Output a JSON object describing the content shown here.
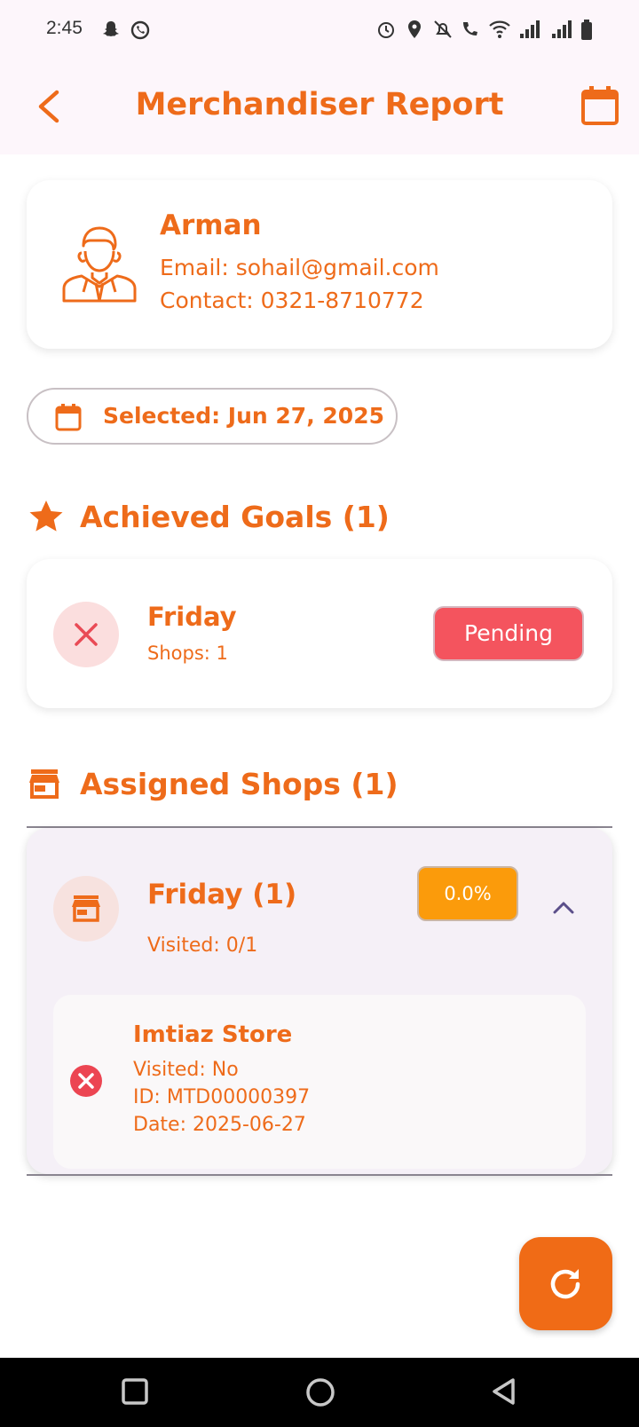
{
  "status_bar": {
    "time": "2:45"
  },
  "app_bar": {
    "title": "Merchandiser Report",
    "back_icon": "chevron-left-icon",
    "calendar_icon": "calendar-icon"
  },
  "profile": {
    "name": "Arman",
    "email": "Email: sohail@gmail.com",
    "contact": "Contact: 0321-8710772",
    "avatar_icon": "person-avatar-icon"
  },
  "date_selector": {
    "label": "Selected: Jun 27, 2025",
    "icon": "calendar-icon"
  },
  "achieved_goals": {
    "title": "Achieved Goals (1)",
    "icon": "star-icon",
    "items": [
      {
        "title": "Friday",
        "subtitle": "Shops: 1",
        "status": "Pending",
        "icon": "close-icon"
      }
    ]
  },
  "assigned_shops": {
    "title": "Assigned Shops (1)",
    "icon": "store-icon",
    "groups": [
      {
        "title": "Friday (1)",
        "visited": "Visited: 0/1",
        "percent": "0.0%",
        "percent_value": 0.0,
        "expanded": true,
        "shops": [
          {
            "name": "Imtiaz Store",
            "visited": "Visited: No",
            "id": "ID: MTD00000397",
            "date": "Date: 2025-06-27",
            "icon": "error-circle-icon"
          }
        ]
      }
    ]
  },
  "fab": {
    "icon": "refresh-icon"
  },
  "colors": {
    "accent": "#ee6b1a",
    "pending": "#f4545e",
    "percent": "#fb9b0b",
    "app_bar_bg": "#fdf6fb"
  }
}
